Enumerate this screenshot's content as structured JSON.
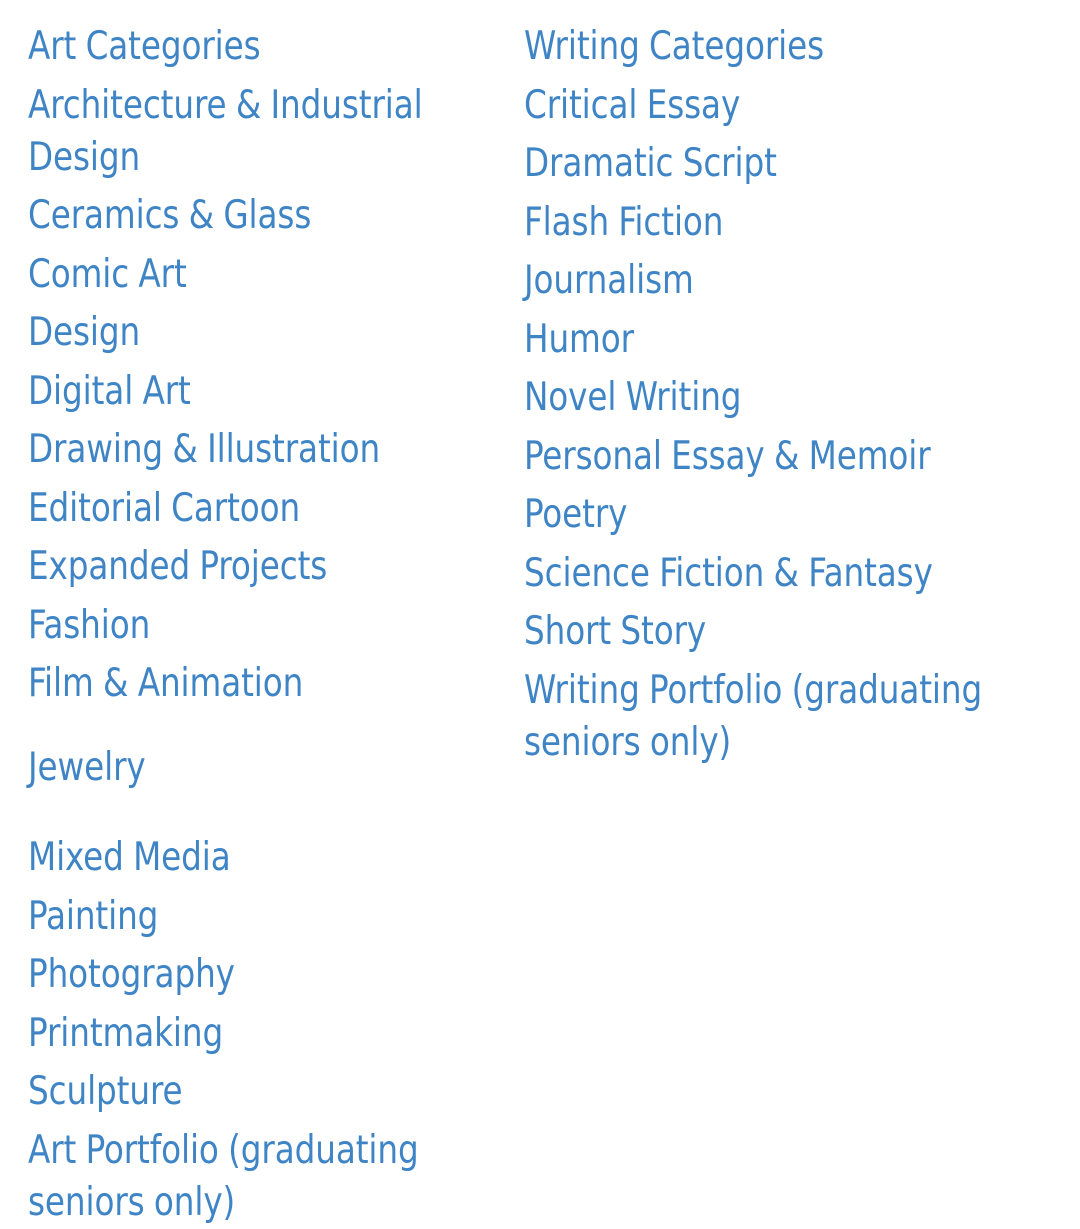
{
  "theme": {
    "background": "#ffffff",
    "link_color": "#3f85c6"
  },
  "columns": [
    {
      "id": "art-categories",
      "heading": "Art Categories",
      "items": [
        "Architecture & Industrial Design",
        "Ceramics & Glass",
        "Comic Art",
        "Design",
        "Digital Art",
        "Drawing & Illustration",
        "Editorial Cartoon",
        "Expanded Projects",
        "Fashion",
        "Film & Animation",
        "Jewelry",
        "Mixed Media",
        "Painting",
        "Photography",
        "Printmaking",
        "Sculpture",
        "Art Portfolio (graduating seniors only)"
      ]
    },
    {
      "id": "writing-categories",
      "heading": "Writing Categories",
      "items": [
        "Critical Essay",
        "Dramatic Script",
        "Flash Fiction",
        "Journalism",
        "Humor",
        "Novel Writing",
        "Personal Essay & Memoir",
        "Poetry",
        "Science Fiction & Fantasy",
        "Short Story",
        "Writing Portfolio (graduating seniors only)"
      ]
    }
  ]
}
